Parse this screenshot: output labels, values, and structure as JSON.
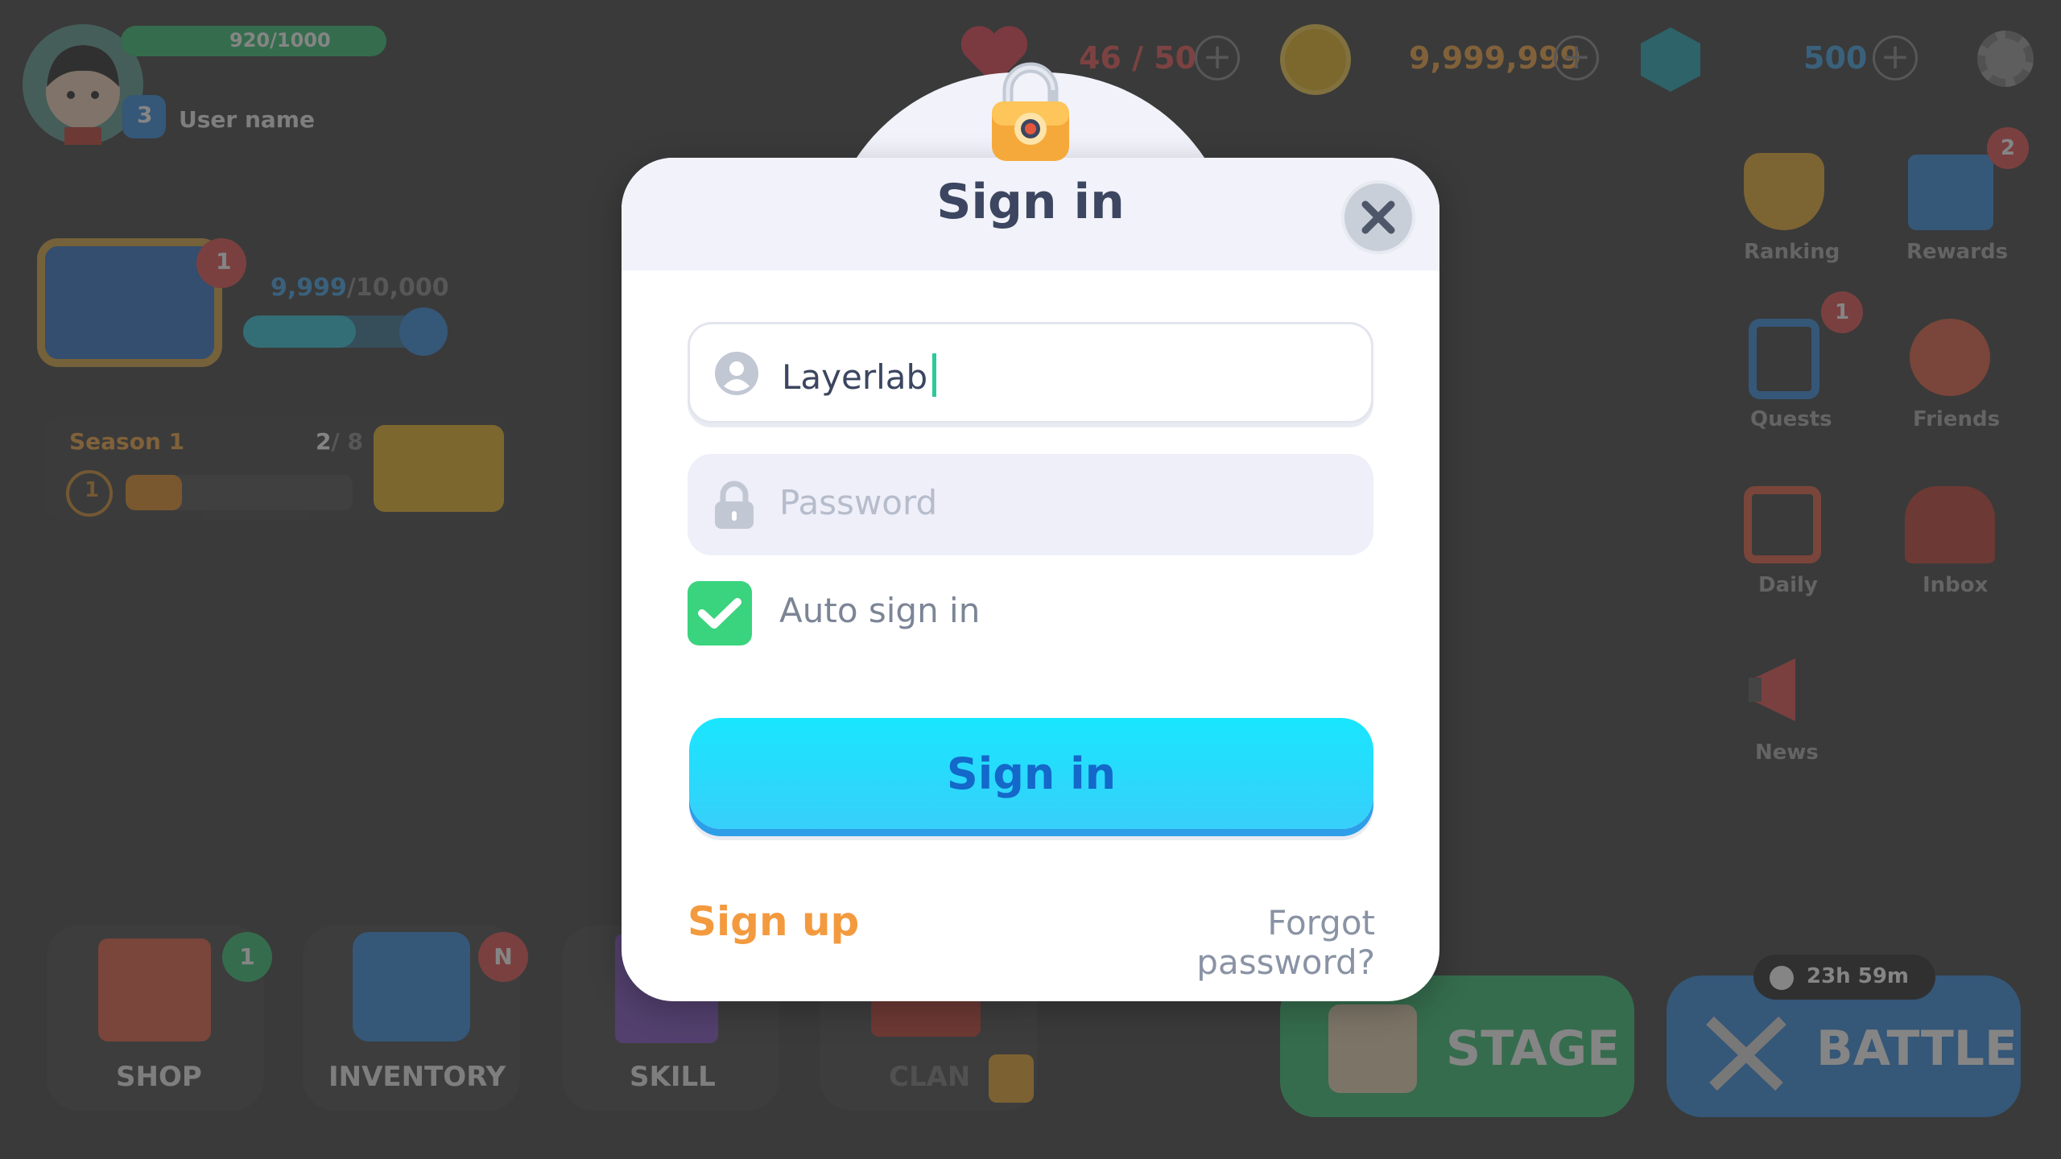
{
  "hud": {
    "exp": "920/1000",
    "level": "3",
    "username": "User name",
    "hearts": "46 / 50",
    "coins": "9,999,999",
    "gems": "500",
    "chest_badge": "1",
    "chest_progress": "9,999",
    "chest_progress_max": "/10,000",
    "season_label": "Season 1",
    "season_count": "2",
    "season_count_max": "/ 8",
    "season_step": "1"
  },
  "side_menu": [
    {
      "label": "Ranking",
      "badge": ""
    },
    {
      "label": "Rewards",
      "badge": "2"
    },
    {
      "label": "Quests",
      "badge": "1"
    },
    {
      "label": "Friends",
      "badge": ""
    },
    {
      "label": "Daily",
      "badge": ""
    },
    {
      "label": "Inbox",
      "badge": ""
    },
    {
      "label": "News",
      "badge": ""
    }
  ],
  "bottom_nav": [
    {
      "label": "SHOP",
      "badge": "1"
    },
    {
      "label": "INVENTORY",
      "badge": "N"
    },
    {
      "label": "SKILL",
      "badge": ""
    },
    {
      "label": "CLAN",
      "badge": ""
    }
  ],
  "stage_label": "STAGE",
  "battle_label": "BATTLE",
  "battle_timer": "23h 59m",
  "modal": {
    "title": "Sign in",
    "username_value": "Layerlab",
    "password_placeholder": "Password",
    "auto_sign_in_label": "Auto sign in",
    "auto_sign_in_checked": true,
    "submit_label": "Sign in",
    "sign_up_label": "Sign up",
    "forgot_label": "Forgot password?"
  },
  "colors": {
    "accent_cyan": "#19e6ff",
    "submit_text": "#1468c9",
    "sign_up": "#f39a3f",
    "checkbox": "#3ad37e"
  }
}
